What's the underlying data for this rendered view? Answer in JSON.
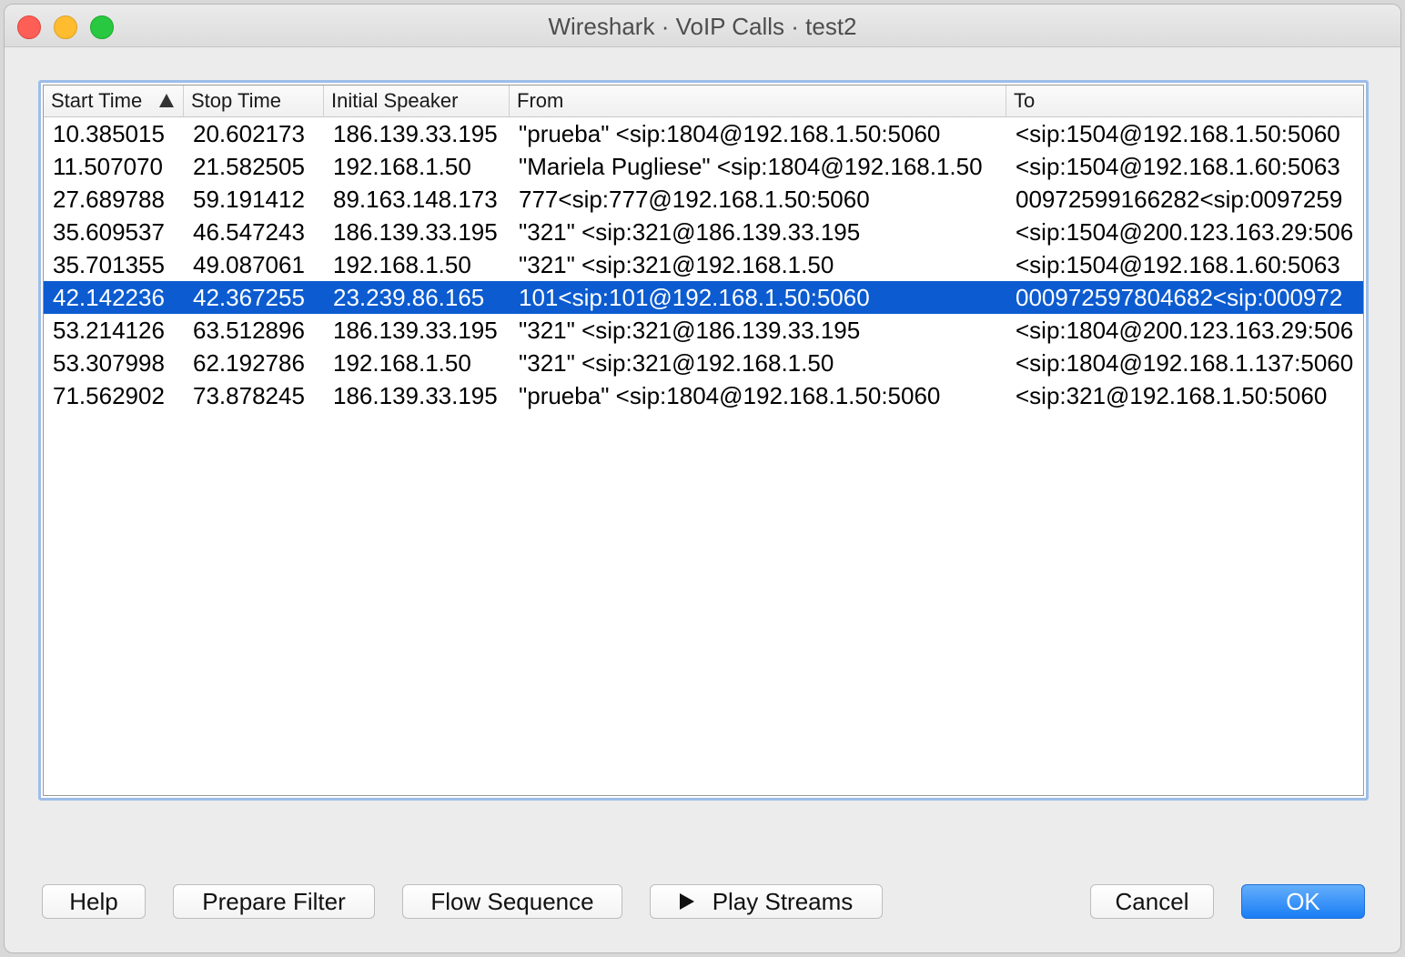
{
  "window": {
    "title": "Wireshark · VoIP Calls · test2"
  },
  "table": {
    "columns": [
      "Start Time",
      "Stop Time",
      "Initial Speaker",
      "From",
      "To"
    ],
    "sorted_column": "Start Time",
    "sort_direction": "ascending",
    "selected_row": 5,
    "rows": [
      [
        "10.385015",
        "20.602173",
        "186.139.33.195",
        "\"prueba\" <sip:1804@192.168.1.50:5060",
        "<sip:1504@192.168.1.50:5060"
      ],
      [
        "11.507070",
        "21.582505",
        "192.168.1.50",
        "\"Mariela Pugliese\" <sip:1804@192.168.1.50",
        "<sip:1504@192.168.1.60:5063"
      ],
      [
        "27.689788",
        "59.191412",
        "89.163.148.173",
        "777<sip:777@192.168.1.50:5060",
        "00972599166282<sip:0097259"
      ],
      [
        "35.609537",
        "46.547243",
        "186.139.33.195",
        "\"321\" <sip:321@186.139.33.195",
        "<sip:1504@200.123.163.29:506"
      ],
      [
        "35.701355",
        "49.087061",
        "192.168.1.50",
        "\"321\" <sip:321@192.168.1.50",
        "<sip:1504@192.168.1.60:5063"
      ],
      [
        "42.142236",
        "42.367255",
        "23.239.86.165",
        "101<sip:101@192.168.1.50:5060",
        "000972597804682<sip:000972"
      ],
      [
        "53.214126",
        "63.512896",
        "186.139.33.195",
        "\"321\" <sip:321@186.139.33.195",
        "<sip:1804@200.123.163.29:506"
      ],
      [
        "53.307998",
        "62.192786",
        "192.168.1.50",
        "\"321\" <sip:321@192.168.1.50",
        "<sip:1804@192.168.1.137:5060"
      ],
      [
        "71.562902",
        "73.878245",
        "186.139.33.195",
        "\"prueba\" <sip:1804@192.168.1.50:5060",
        "<sip:321@192.168.1.50:5060"
      ]
    ]
  },
  "buttons": {
    "help": "Help",
    "prepare_filter": "Prepare Filter",
    "flow_sequence": "Flow Sequence",
    "play_streams": "Play Streams",
    "cancel": "Cancel",
    "ok": "OK"
  },
  "icons": {
    "sort": "sort-ascending-icon",
    "play": "play-icon"
  },
  "colors": {
    "selection": "#0c5bd0",
    "primary_button": "#1a7ef5",
    "focus_ring": "#9cbde9"
  }
}
